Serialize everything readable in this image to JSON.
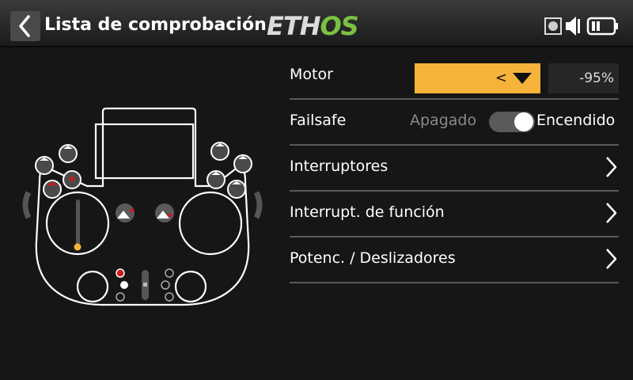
{
  "header": {
    "title": "Lista de comprobación",
    "logo_text": "ETHOS",
    "icons": [
      "back-chevron-icon",
      "record-icon",
      "speaker-icon",
      "battery-icon"
    ]
  },
  "rows": [
    {
      "label": "Motor",
      "dropdown_value": "<",
      "percent": "-95%"
    },
    {
      "label": "Failsafe",
      "off_label": "Apagado",
      "on_label": "Encendido",
      "toggle_on": true
    },
    {
      "label": "Interruptores"
    },
    {
      "label": "Interrupt. de función"
    },
    {
      "label": "Potenc. / Deslizadores"
    }
  ],
  "colors": {
    "accent": "#f6b33a",
    "logo_green": "#7bc142",
    "alert_red": "#d0181e",
    "background": "#161616"
  }
}
